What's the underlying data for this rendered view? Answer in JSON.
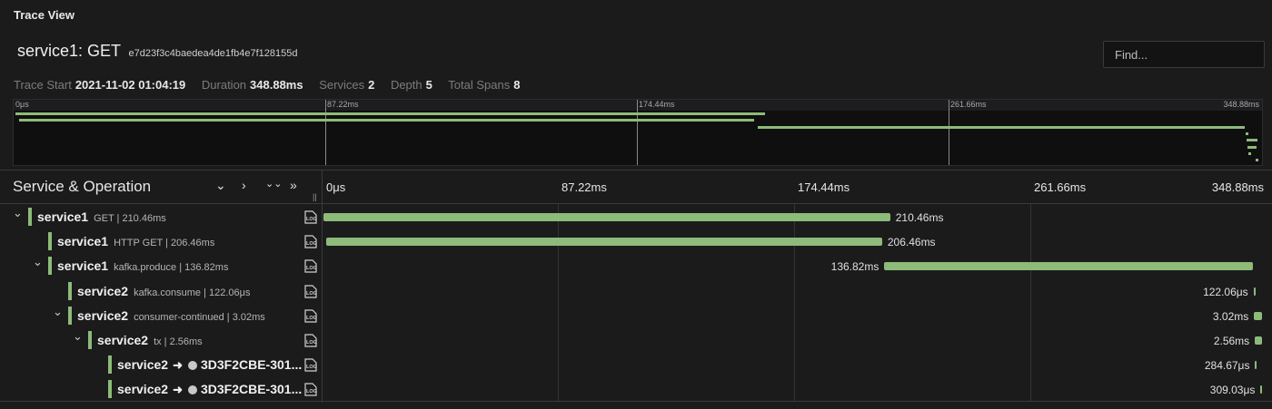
{
  "app": {
    "title": "Trace View"
  },
  "trace": {
    "service": "service1: GET",
    "id": "e7d23f3c4baedea4de1fb4e7f128155d"
  },
  "find": {
    "placeholder": "Find..."
  },
  "meta": {
    "trace_start_label": "Trace Start",
    "trace_start_value": "2021-11-02 01:04:19",
    "duration_label": "Duration",
    "duration_value": "348.88ms",
    "services_label": "Services",
    "services_value": "2",
    "depth_label": "Depth",
    "depth_value": "5",
    "total_spans_label": "Total Spans",
    "total_spans_value": "8"
  },
  "minimap": {
    "ticks": [
      "0μs",
      "87.22ms",
      "174.44ms",
      "261.66ms",
      "348.88ms"
    ]
  },
  "header": {
    "title": "Service & Operation",
    "controls": [
      "⌄",
      "›",
      "⌄⌄",
      "»"
    ],
    "ticks": [
      "0μs",
      "87.22ms",
      "174.44ms",
      "261.66ms",
      "348.88ms"
    ]
  },
  "colors": {
    "accent": "#8dbb79",
    "background": "#1b1b1c"
  },
  "spans": [
    {
      "service": "service1",
      "operation": "GET | 210.46ms",
      "duration": "210.46ms",
      "start_ms": 0,
      "end_ms": 210.46,
      "depth": 0,
      "has_children": true,
      "icon": "log-icon"
    },
    {
      "service": "service1",
      "operation": "HTTP GET | 206.46ms",
      "duration": "206.46ms",
      "start_ms": 1,
      "end_ms": 207.46,
      "depth": 1,
      "has_children": false,
      "icon": "log-icon"
    },
    {
      "service": "service1",
      "operation": "kafka.produce | 136.82ms",
      "duration": "136.82ms",
      "start_ms": 208.3,
      "end_ms": 345.12,
      "depth": 1,
      "has_children": true,
      "icon": "log-icon"
    },
    {
      "service": "service2",
      "operation": "kafka.consume | 122.06μs",
      "duration": "122.06μs",
      "start_ms": 345.4,
      "end_ms": 345.52,
      "depth": 2,
      "has_children": false,
      "icon": "log-icon"
    },
    {
      "service": "service2",
      "operation": "consumer-continued | 3.02ms",
      "duration": "3.02ms",
      "start_ms": 345.6,
      "end_ms": 348.62,
      "depth": 2,
      "has_children": true,
      "icon": "log-icon"
    },
    {
      "service": "service2",
      "operation": "tx | 2.56ms",
      "duration": "2.56ms",
      "start_ms": 345.9,
      "end_ms": 348.46,
      "depth": 3,
      "has_children": true,
      "icon": "log-icon"
    },
    {
      "service": "service2",
      "peer": "3D3F2CBE-301...",
      "duration": "284.67μs",
      "start_ms": 346.0,
      "end_ms": 346.28,
      "depth": 4,
      "has_children": false,
      "icon": "log-icon"
    },
    {
      "service": "service2",
      "peer": "3D3F2CBE-301...",
      "duration": "309.03μs",
      "start_ms": 348.0,
      "end_ms": 348.31,
      "depth": 4,
      "has_children": false,
      "icon": "log-icon"
    }
  ]
}
